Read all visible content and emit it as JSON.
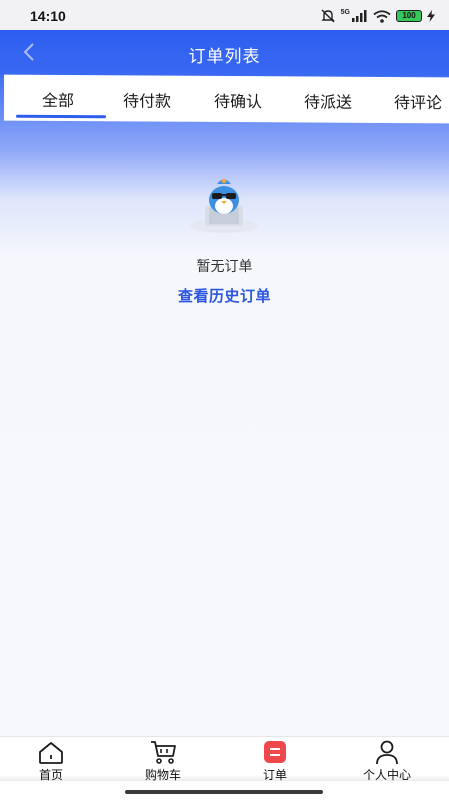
{
  "status_bar": {
    "time": "14:10",
    "network": "5G",
    "battery": "100",
    "icons": [
      "mute-icon",
      "signal-icon",
      "wifi-icon",
      "battery-icon",
      "charging-icon"
    ]
  },
  "header": {
    "title": "订单列表",
    "back_icon": "chevron-left-icon"
  },
  "tabs": [
    {
      "label": "全部",
      "active": true
    },
    {
      "label": "待付款",
      "active": false
    },
    {
      "label": "待确认",
      "active": false
    },
    {
      "label": "待派送",
      "active": false
    },
    {
      "label": "待评论",
      "active": false
    }
  ],
  "empty_state": {
    "illustration": "penguin-with-sunglasses-illustration",
    "message": "暂无订单",
    "link": "查看历史订单"
  },
  "bottom_nav": [
    {
      "label": "首页",
      "icon": "home-icon",
      "active": false
    },
    {
      "label": "购物车",
      "icon": "cart-icon",
      "active": false
    },
    {
      "label": "订单",
      "icon": "order-icon",
      "active": true
    },
    {
      "label": "个人中心",
      "icon": "person-icon",
      "active": false
    }
  ],
  "colors": {
    "primary": "#2d5def",
    "link": "#2b56e0",
    "active_nav": "#f0474a"
  }
}
